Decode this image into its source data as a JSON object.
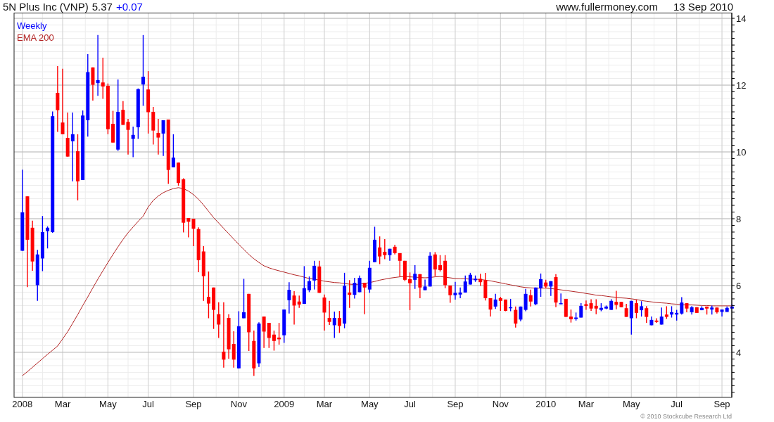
{
  "header": {
    "title": "5N Plus Inc (VNP)",
    "price": "5.37",
    "change": "+0.07",
    "site": "www.fullermoney.com",
    "date": "13 Sep 2010"
  },
  "legend": [
    {
      "label": "Weekly",
      "color": "#0000ff"
    }
  ],
  "chart_data": {
    "type": "candlestick",
    "grid": true,
    "ylim": [
      2.65,
      14.17
    ],
    "yticks": [
      4,
      6,
      8,
      10,
      12,
      14
    ],
    "categories": [
      "2008",
      null,
      null,
      null,
      null,
      null,
      null,
      null,
      "Mar",
      null,
      null,
      null,
      null,
      null,
      null,
      null,
      null,
      "May",
      null,
      null,
      null,
      null,
      null,
      null,
      null,
      "Jul",
      null,
      null,
      null,
      null,
      null,
      null,
      null,
      null,
      "Sep",
      null,
      null,
      null,
      null,
      null,
      null,
      null,
      null,
      "Nov",
      null,
      null,
      null,
      null,
      null,
      null,
      null,
      null,
      "2009",
      null,
      null,
      null,
      null,
      null,
      null,
      null,
      "Mar",
      null,
      null,
      null,
      null,
      null,
      null,
      null,
      null,
      "May",
      null,
      null,
      null,
      null,
      null,
      null,
      null,
      "Jul",
      null,
      null,
      null,
      null,
      null,
      null,
      null,
      null,
      "Sep",
      null,
      null,
      null,
      null,
      null,
      null,
      null,
      null,
      "Nov",
      null,
      null,
      null,
      null,
      null,
      null,
      null,
      null,
      "2010",
      null,
      null,
      null,
      null,
      null,
      null,
      null,
      "Mar",
      null,
      null,
      null,
      null,
      null,
      null,
      null,
      null,
      "May",
      null,
      null,
      null,
      null,
      null,
      null,
      null,
      null,
      "Jul",
      null,
      null,
      null,
      null,
      null,
      null,
      null,
      null,
      "Sep",
      null,
      null
    ],
    "ohlc": [
      [
        7.04,
        9.47,
        7.04,
        8.19
      ],
      [
        8.67,
        8.67,
        5.95,
        7.37
      ],
      [
        7.73,
        7.94,
        6.44,
        6.72
      ],
      [
        6.01,
        7.07,
        5.54,
        6.93
      ],
      [
        6.81,
        8.08,
        6.43,
        7.6
      ],
      [
        7.63,
        7.77,
        7.11,
        7.73
      ],
      [
        7.6,
        11.21,
        7.58,
        11.07
      ],
      [
        11.77,
        12.57,
        10.6,
        11.25
      ],
      [
        10.88,
        12.49,
        10.53,
        10.53
      ],
      [
        10.42,
        11.18,
        9.86,
        9.86
      ],
      [
        10.32,
        11.18,
        9.12,
        10.53
      ],
      [
        10.02,
        10.53,
        8.55,
        9.12
      ],
      [
        9.16,
        11.24,
        9.16,
        11.09
      ],
      [
        10.95,
        12.93,
        10.46,
        12.39
      ],
      [
        12.53,
        12.53,
        11.54,
        12.01
      ],
      [
        12.06,
        13.5,
        11.68,
        12.15
      ],
      [
        12.08,
        12.82,
        11.59,
        11.96
      ],
      [
        11.98,
        12.05,
        10.53,
        10.68
      ],
      [
        10.84,
        11.23,
        10.28,
        10.28
      ],
      [
        10.07,
        12.17,
        10.03,
        11.2
      ],
      [
        11.26,
        11.52,
        10.81,
        10.81
      ],
      [
        10.9,
        10.99,
        9.92,
        10.66
      ],
      [
        10.39,
        10.76,
        9.84,
        10.51
      ],
      [
        10.74,
        11.9,
        10.39,
        11.88
      ],
      [
        12.02,
        13.5,
        11.38,
        12.25
      ],
      [
        11.87,
        12.42,
        10.55,
        11.19
      ],
      [
        11.2,
        11.35,
        10.22,
        10.64
      ],
      [
        10.57,
        10.99,
        9.92,
        10.43
      ],
      [
        10.55,
        10.95,
        9.88,
        10.95
      ],
      [
        10.97,
        10.97,
        9.04,
        9.46
      ],
      [
        9.54,
        10.53,
        9.54,
        9.83
      ],
      [
        9.68,
        9.68,
        8.99,
        9.07
      ],
      [
        9.18,
        9.21,
        7.59,
        7.88
      ],
      [
        8.02,
        8.02,
        7.44,
        7.91
      ],
      [
        8.0,
        8.0,
        7.18,
        7.7
      ],
      [
        7.69,
        7.74,
        6.4,
        6.76
      ],
      [
        7.02,
        7.18,
        5.54,
        6.28
      ],
      [
        5.66,
        6.42,
        5.02,
        5.46
      ],
      [
        5.94,
        5.94,
        4.7,
        5.27
      ],
      [
        5.14,
        5.5,
        4.43,
        4.83
      ],
      [
        4.02,
        5.5,
        3.54,
        3.78
      ],
      [
        5.03,
        5.14,
        3.81,
        4.09
      ],
      [
        4.25,
        4.63,
        3.54,
        3.78
      ],
      [
        3.52,
        5.23,
        3.52,
        4.78
      ],
      [
        5.02,
        6.2,
        5.02,
        5.2
      ],
      [
        5.75,
        5.75,
        4.04,
        4.6
      ],
      [
        4.34,
        4.65,
        3.29,
        3.52
      ],
      [
        3.67,
        4.9,
        3.56,
        4.86
      ],
      [
        5.07,
        5.07,
        4.13,
        4.62
      ],
      [
        4.88,
        4.88,
        4.13,
        4.43
      ],
      [
        4.53,
        4.65,
        4.05,
        4.34
      ],
      [
        4.44,
        4.88,
        4.23,
        4.39
      ],
      [
        4.51,
        5.28,
        4.28,
        5.28
      ],
      [
        5.56,
        6.1,
        5.16,
        5.87
      ],
      [
        5.7,
        5.83,
        4.83,
        5.4
      ],
      [
        5.52,
        5.7,
        5.33,
        5.43
      ],
      [
        5.45,
        6.58,
        5.45,
        5.92
      ],
      [
        5.86,
        6.27,
        5.8,
        6.13
      ],
      [
        6.15,
        6.74,
        5.88,
        6.59
      ],
      [
        6.57,
        6.74,
        5.78,
        5.78
      ],
      [
        5.64,
        5.73,
        4.65,
        5.19
      ],
      [
        5.03,
        5.54,
        4.82,
        4.91
      ],
      [
        4.81,
        5.22,
        4.43,
        5.03
      ],
      [
        5.03,
        5.24,
        4.58,
        4.79
      ],
      [
        4.86,
        6.38,
        4.72,
        5.99
      ],
      [
        5.79,
        6.16,
        5.33,
        5.72
      ],
      [
        5.72,
        6.23,
        5.61,
        6.08
      ],
      [
        5.8,
        6.3,
        5.8,
        6.23
      ],
      [
        6.08,
        6.08,
        5.14,
        5.94
      ],
      [
        5.88,
        6.74,
        5.78,
        6.53
      ],
      [
        6.7,
        7.76,
        6.7,
        7.37
      ],
      [
        7.14,
        7.47,
        6.64,
        6.87
      ],
      [
        7.01,
        7.39,
        6.79,
        6.91
      ],
      [
        6.91,
        7.1,
        6.74,
        7.1
      ],
      [
        7.16,
        7.22,
        6.93,
        6.97
      ],
      [
        6.97,
        6.97,
        6.27,
        6.74
      ],
      [
        6.74,
        6.74,
        6.13,
        6.17
      ],
      [
        6.19,
        6.39,
        5.26,
        6.07
      ],
      [
        6.17,
        6.61,
        5.9,
        6.35
      ],
      [
        6.34,
        6.34,
        5.62,
        5.94
      ],
      [
        5.86,
        6.18,
        5.86,
        5.97
      ],
      [
        5.97,
        7.0,
        5.97,
        6.89
      ],
      [
        6.93,
        7.0,
        6.28,
        6.48
      ],
      [
        6.61,
        6.91,
        6.42,
        6.46
      ],
      [
        6.74,
        6.91,
        5.92,
        6.01
      ],
      [
        6.0,
        6.0,
        5.48,
        5.71
      ],
      [
        5.71,
        6.11,
        5.58,
        5.78
      ],
      [
        5.73,
        5.94,
        5.62,
        5.79
      ],
      [
        5.79,
        6.3,
        5.79,
        6.12
      ],
      [
        6.03,
        6.38,
        6.03,
        6.32
      ],
      [
        6.16,
        6.3,
        6.11,
        6.2
      ],
      [
        6.2,
        6.35,
        5.99,
        6.1
      ],
      [
        6.16,
        6.38,
        5.55,
        5.62
      ],
      [
        5.62,
        5.62,
        5.07,
        5.28
      ],
      [
        5.37,
        5.75,
        5.3,
        5.58
      ],
      [
        5.62,
        5.66,
        5.24,
        5.54
      ],
      [
        5.58,
        5.58,
        5.23,
        5.24
      ],
      [
        5.32,
        5.6,
        5.23,
        5.35
      ],
      [
        5.27,
        5.37,
        4.74,
        4.86
      ],
      [
        4.98,
        5.37,
        4.93,
        5.37
      ],
      [
        5.27,
        5.9,
        5.23,
        5.75
      ],
      [
        5.71,
        5.88,
        5.37,
        5.52
      ],
      [
        5.44,
        5.94,
        5.41,
        5.94
      ],
      [
        5.92,
        6.36,
        5.66,
        6.19
      ],
      [
        6.09,
        6.17,
        5.92,
        5.97
      ],
      [
        5.97,
        6.13,
        5.69,
        6.13
      ],
      [
        6.25,
        6.34,
        5.35,
        5.49
      ],
      [
        5.44,
        5.76,
        5.44,
        5.47
      ],
      [
        5.6,
        5.6,
        5.06,
        5.06
      ],
      [
        5.07,
        5.28,
        4.89,
        4.99
      ],
      [
        5.0,
        5.19,
        4.95,
        5.04
      ],
      [
        5.04,
        5.47,
        5.04,
        5.39
      ],
      [
        5.44,
        5.55,
        5.27,
        5.39
      ],
      [
        5.47,
        5.59,
        5.24,
        5.31
      ],
      [
        5.39,
        5.59,
        5.14,
        5.31
      ],
      [
        5.27,
        5.47,
        5.23,
        5.33
      ],
      [
        5.31,
        5.4,
        5.29,
        5.37
      ],
      [
        5.27,
        5.59,
        5.27,
        5.54
      ],
      [
        5.51,
        5.84,
        5.29,
        5.42
      ],
      [
        5.51,
        5.51,
        5.35,
        5.35
      ],
      [
        5.32,
        5.45,
        5.06,
        5.06
      ],
      [
        5.02,
        5.54,
        4.53,
        5.54
      ],
      [
        5.47,
        5.58,
        5.02,
        5.18
      ],
      [
        5.26,
        5.53,
        5.07,
        5.38
      ],
      [
        5.32,
        5.38,
        4.88,
        5.06
      ],
      [
        4.81,
        5.07,
        4.81,
        4.97
      ],
      [
        4.95,
        5.02,
        4.88,
        4.91
      ],
      [
        4.83,
        5.34,
        4.83,
        5.07
      ],
      [
        5.13,
        5.38,
        5.0,
        5.06
      ],
      [
        5.13,
        5.38,
        5.04,
        5.2
      ],
      [
        5.13,
        5.27,
        4.95,
        5.18
      ],
      [
        5.16,
        5.65,
        5.13,
        5.49
      ],
      [
        5.47,
        5.47,
        5.2,
        5.31
      ],
      [
        5.2,
        5.38,
        5.13,
        5.35
      ],
      [
        5.35,
        5.35,
        5.18,
        5.18
      ],
      [
        5.26,
        5.38,
        5.26,
        5.33
      ],
      [
        5.37,
        5.37,
        5.13,
        5.31
      ],
      [
        5.28,
        5.4,
        5.13,
        5.34
      ],
      [
        5.34,
        5.34,
        5.16,
        5.2
      ],
      [
        5.21,
        5.28,
        5.07,
        5.28
      ],
      [
        5.21,
        5.37,
        5.21,
        5.33
      ],
      [
        5.31,
        5.44,
        5.31,
        5.37
      ]
    ],
    "series": [
      {
        "name": "EMA 200",
        "type": "line",
        "color": "#b22222",
        "values": [
          3.3,
          3.42,
          3.55,
          3.68,
          3.81,
          3.94,
          4.06,
          4.19,
          4.4,
          4.62,
          4.87,
          5.13,
          5.4,
          5.66,
          5.93,
          6.19,
          6.44,
          6.69,
          6.93,
          7.16,
          7.38,
          7.58,
          7.75,
          7.92,
          8.08,
          8.35,
          8.55,
          8.68,
          8.78,
          8.85,
          8.9,
          8.93,
          8.9,
          8.83,
          8.72,
          8.58,
          8.41,
          8.22,
          8.03,
          7.87,
          7.71,
          7.55,
          7.39,
          7.23,
          7.08,
          6.93,
          6.8,
          6.69,
          6.59,
          6.53,
          6.48,
          6.44,
          6.4,
          6.36,
          6.32,
          6.29,
          6.25,
          6.21,
          6.19,
          6.16,
          6.13,
          6.11,
          6.09,
          6.08,
          6.06,
          6.04,
          6.03,
          6.04,
          6.06,
          6.09,
          6.12,
          6.16,
          6.19,
          6.22,
          6.24,
          6.26,
          6.27,
          6.26,
          6.25,
          6.24,
          6.23,
          6.24,
          6.26,
          6.27,
          6.25,
          6.23,
          6.21,
          6.2,
          6.2,
          6.19,
          6.19,
          6.18,
          6.16,
          6.14,
          6.11,
          6.08,
          6.05,
          6.02,
          5.99,
          5.96,
          5.94,
          5.93,
          5.92,
          5.92,
          5.92,
          5.91,
          5.89,
          5.87,
          5.85,
          5.83,
          5.81,
          5.79,
          5.76,
          5.74,
          5.71,
          5.7,
          5.68,
          5.66,
          5.65,
          5.63,
          5.62,
          5.6,
          5.58,
          5.55,
          5.53,
          5.51,
          5.49,
          5.48,
          5.47,
          5.45,
          5.44,
          5.43,
          5.42,
          5.42,
          5.41,
          5.4,
          5.4,
          5.39,
          5.39,
          5.39,
          5.39,
          5.39
        ]
      }
    ]
  },
  "footer": {
    "copyright": "© 2010 Stockcube Research Ltd"
  }
}
